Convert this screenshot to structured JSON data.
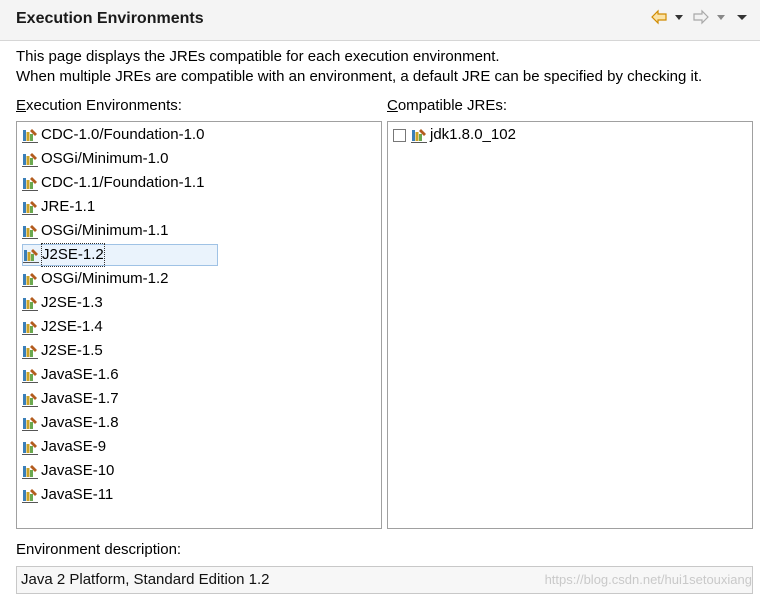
{
  "header": {
    "title": "Execution Environments",
    "back_icon": "back-arrow-icon",
    "forward_icon": "forward-arrow-icon",
    "accent_color": "#e8a317"
  },
  "description": {
    "line1": "This page displays the JREs compatible for each execution environment.",
    "line2": "When multiple JREs are compatible with an environment, a default JRE can be specified by checking it."
  },
  "environments": {
    "label_prefix": "E",
    "label_rest": "xecution Environments:",
    "items": [
      "CDC-1.0/Foundation-1.0",
      "OSGi/Minimum-1.0",
      "CDC-1.1/Foundation-1.1",
      "JRE-1.1",
      "OSGi/Minimum-1.1",
      "J2SE-1.2",
      "OSGi/Minimum-1.2",
      "J2SE-1.3",
      "J2SE-1.4",
      "J2SE-1.5",
      "JavaSE-1.6",
      "JavaSE-1.7",
      "JavaSE-1.8",
      "JavaSE-9",
      "JavaSE-10",
      "JavaSE-11"
    ],
    "selected": "J2SE-1.2"
  },
  "compatible": {
    "label_prefix": "C",
    "label_rest": "ompatible JREs:",
    "items": [
      "jdk1.8.0_102"
    ]
  },
  "env_description": {
    "label": "Environment description:",
    "value": "Java 2 Platform, Standard Edition 1.2"
  },
  "watermark": "https://blog.csdn.net/hui1setouxiang"
}
